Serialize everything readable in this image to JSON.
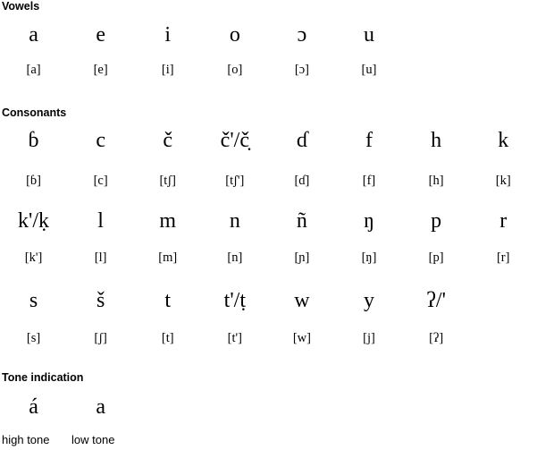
{
  "sections": {
    "vowels": {
      "title": "Vowels",
      "letters": [
        "a",
        "e",
        "i",
        "o",
        "ɔ",
        "u",
        "",
        ""
      ],
      "ipa": [
        "[a]",
        "[e]",
        "[i]",
        "[o]",
        "[ɔ]",
        "[u]",
        "",
        ""
      ]
    },
    "consonants": {
      "title": "Consonants",
      "rows": [
        {
          "letters": [
            "ɓ",
            "c",
            "č",
            "č'/č̣",
            "ɗ",
            "f",
            "h",
            "k"
          ],
          "ipa": [
            "[ɓ]",
            "[c]",
            "[tʃ]",
            "[tʃ']",
            "[ɗ]",
            "[f]",
            "[h]",
            "[k]"
          ]
        },
        {
          "letters": [
            "k'/ḳ",
            "l",
            "m",
            "n",
            "ñ",
            "ŋ",
            "p",
            "r"
          ],
          "ipa": [
            "[k']",
            "[l]",
            "[m]",
            "[n]",
            "[ɲ]",
            "[ŋ]",
            "[p]",
            "[r]"
          ]
        },
        {
          "letters": [
            "s",
            "š",
            "t",
            "t'/ṭ",
            "w",
            "y",
            "ʔ/'",
            ""
          ],
          "ipa": [
            "[s]",
            "[ʃ]",
            "[t]",
            "[t']",
            "[w]",
            "[j]",
            "[ʔ]",
            ""
          ]
        }
      ]
    },
    "tone": {
      "title": "Tone indication",
      "letters": [
        "á",
        "a",
        "",
        "",
        "",
        "",
        "",
        ""
      ],
      "high_label": "high tone",
      "low_label": "low tone"
    }
  },
  "colors": {
    "text": "#000000",
    "background": "#ffffff"
  }
}
